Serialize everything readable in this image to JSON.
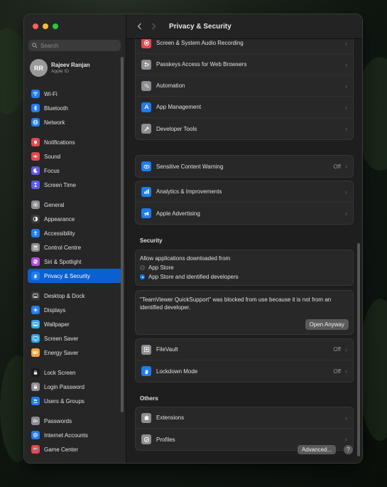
{
  "window": {
    "title": "Privacy & Security"
  },
  "search": {
    "placeholder": "Search"
  },
  "account": {
    "initials": "RR",
    "name": "Rajeev Ranjan",
    "subtitle": "Apple ID"
  },
  "sidebar": {
    "items": [
      {
        "label": "Wi-Fi",
        "icon": "wifi-icon",
        "color": "#1f7cf0"
      },
      {
        "label": "Bluetooth",
        "icon": "bluetooth-icon",
        "color": "#1f7cf0"
      },
      {
        "label": "Network",
        "icon": "globe-icon",
        "color": "#1f7cf0"
      },
      {
        "label": "Notifications",
        "icon": "bell-icon",
        "color": "#e5484d"
      },
      {
        "label": "Sound",
        "icon": "speaker-icon",
        "color": "#e5484d"
      },
      {
        "label": "Focus",
        "icon": "moon-icon",
        "color": "#5e5ce6"
      },
      {
        "label": "Screen Time",
        "icon": "hourglass-icon",
        "color": "#5e5ce6"
      },
      {
        "label": "General",
        "icon": "gear-icon",
        "color": "#8e8e93"
      },
      {
        "label": "Appearance",
        "icon": "appearance-icon",
        "color": "#3a3a3c"
      },
      {
        "label": "Accessibility",
        "icon": "accessibility-icon",
        "color": "#1f7cf0"
      },
      {
        "label": "Control Centre",
        "icon": "control-centre-icon",
        "color": "#8e8e93"
      },
      {
        "label": "Siri & Spotlight",
        "icon": "siri-icon",
        "color": "#b44ee8"
      },
      {
        "label": "Privacy & Security",
        "icon": "hand-icon",
        "color": "#1f7cf0"
      },
      {
        "label": "Desktop & Dock",
        "icon": "dock-icon",
        "color": "#3a3a3c"
      },
      {
        "label": "Displays",
        "icon": "sun-icon",
        "color": "#1f7cf0"
      },
      {
        "label": "Wallpaper",
        "icon": "wallpaper-icon",
        "color": "#2ea8e6"
      },
      {
        "label": "Screen Saver",
        "icon": "screensaver-icon",
        "color": "#2ea8e6"
      },
      {
        "label": "Energy Saver",
        "icon": "battery-icon",
        "color": "#f2a33a"
      },
      {
        "label": "Lock Screen",
        "icon": "lock-icon",
        "color": "#1c1c1e"
      },
      {
        "label": "Login Password",
        "icon": "lock-key-icon",
        "color": "#8e8e93"
      },
      {
        "label": "Users & Groups",
        "icon": "users-icon",
        "color": "#1f7cf0"
      },
      {
        "label": "Passwords",
        "icon": "key-icon",
        "color": "#8e8e93"
      },
      {
        "label": "Internet Accounts",
        "icon": "at-icon",
        "color": "#1f7cf0"
      },
      {
        "label": "Game Center",
        "icon": "game-center-icon",
        "color": "#e5484d"
      }
    ]
  },
  "groups": {
    "privacy": [
      {
        "label": "Screen & System Audio Recording",
        "icon": "record-icon",
        "color": "#e5484d"
      },
      {
        "label": "Passkeys Access for Web Browsers",
        "icon": "passkey-icon",
        "color": "#8e8e93"
      },
      {
        "label": "Automation",
        "icon": "automation-icon",
        "color": "#8e8e93"
      },
      {
        "label": "App Management",
        "icon": "app-store-icon",
        "color": "#1f7cf0"
      },
      {
        "label": "Developer Tools",
        "icon": "hammer-icon",
        "color": "#8e8e93"
      }
    ],
    "sensitive": {
      "label": "Sensitive Content Warning",
      "value": "Off",
      "icon": "eye-icon",
      "color": "#1f7cf0"
    },
    "analytics": [
      {
        "label": "Analytics & Improvements",
        "icon": "chart-icon",
        "color": "#1f7cf0"
      },
      {
        "label": "Apple Advertising",
        "icon": "megaphone-icon",
        "color": "#1f7cf0"
      }
    ]
  },
  "security": {
    "title": "Security",
    "allow_label": "Allow applications downloaded from",
    "options": [
      {
        "label": "App Store",
        "selected": false
      },
      {
        "label": "App Store and identified developers",
        "selected": true
      }
    ],
    "blocked_message": "\"TeamViewer QuickSupport\" was blocked from use because it is not from an identified developer.",
    "open_anyway": "Open Anyway",
    "filevault": {
      "label": "FileVault",
      "value": "Off",
      "icon": "filevault-icon",
      "color": "#8e8e93"
    },
    "lockdown": {
      "label": "Lockdown Mode",
      "value": "Off",
      "icon": "hand-icon",
      "color": "#1f7cf0"
    }
  },
  "others": {
    "title": "Others",
    "items": [
      {
        "label": "Extensions",
        "icon": "extensions-icon",
        "color": "#8e8e93"
      },
      {
        "label": "Profiles",
        "icon": "profiles-icon",
        "color": "#8e8e93"
      }
    ]
  },
  "footer": {
    "advanced": "Advanced...",
    "help": "?"
  }
}
